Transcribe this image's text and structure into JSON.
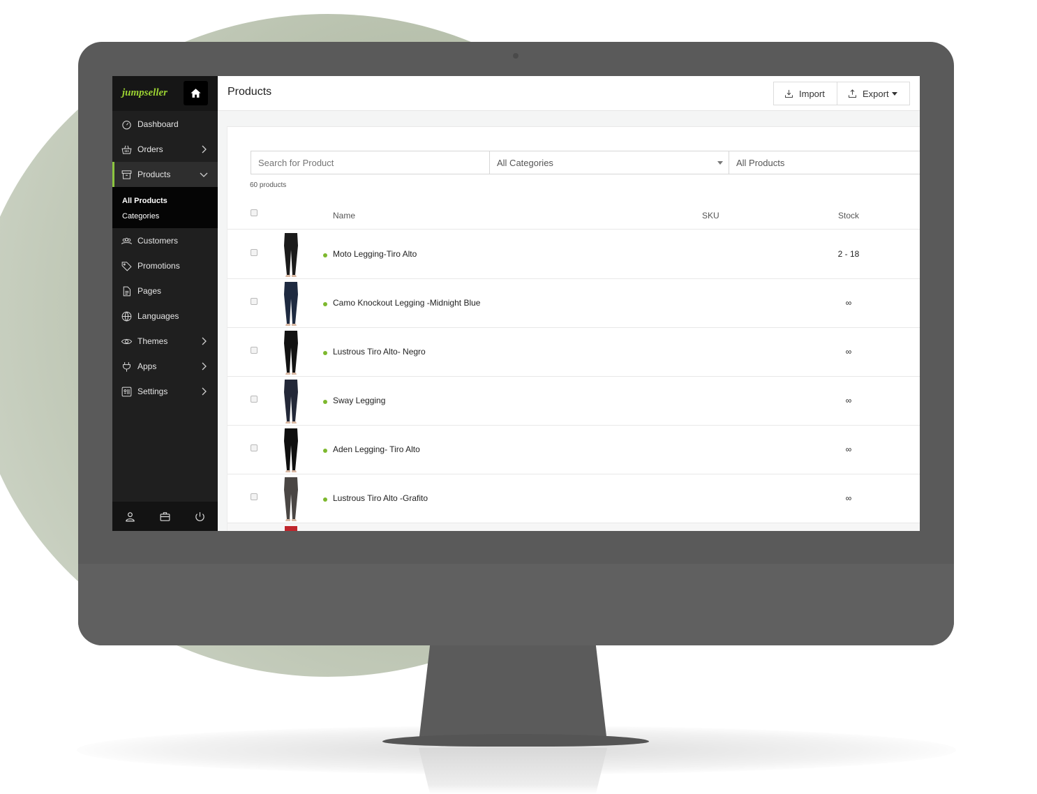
{
  "brand": {
    "logo_text": "jumpseller",
    "accent": "#8cc63f"
  },
  "sidebar": {
    "items": [
      {
        "label": "Dashboard",
        "icon": "gauge-icon",
        "chevron": false
      },
      {
        "label": "Orders",
        "icon": "basket-icon",
        "chevron": true
      },
      {
        "label": "Products",
        "icon": "box-icon",
        "chevron": true,
        "active": true
      },
      {
        "label": "Customers",
        "icon": "users-icon",
        "chevron": false
      },
      {
        "label": "Promotions",
        "icon": "tag-icon",
        "chevron": false
      },
      {
        "label": "Pages",
        "icon": "page-icon",
        "chevron": false
      },
      {
        "label": "Languages",
        "icon": "globe-icon",
        "chevron": false
      },
      {
        "label": "Themes",
        "icon": "eye-icon",
        "chevron": true
      },
      {
        "label": "Apps",
        "icon": "plug-icon",
        "chevron": true
      },
      {
        "label": "Settings",
        "icon": "settings-icon",
        "chevron": true
      }
    ],
    "submenu": [
      "All Products",
      "Categories"
    ],
    "footer_icons": [
      "user-icon",
      "briefcase-icon",
      "power-icon"
    ]
  },
  "header": {
    "title": "Products",
    "import_label": "Import",
    "export_label": "Export"
  },
  "filters": {
    "search_placeholder": "Search for Product",
    "category": "All Categories",
    "scope": "All Products"
  },
  "count_text": "60 products",
  "columns": {
    "name": "Name",
    "sku": "SKU",
    "stock": "Stock"
  },
  "products": [
    {
      "name": "Moto Legging-Tiro Alto",
      "stock": "2 - 18",
      "color": "#1b1b1b"
    },
    {
      "name": "Camo Knockout Legging -Midnight Blue",
      "stock": "∞",
      "color": "#1e2a40"
    },
    {
      "name": "Lustrous Tiro Alto- Negro",
      "stock": "∞",
      "color": "#121212"
    },
    {
      "name": "Sway Legging",
      "stock": "∞",
      "color": "#232838"
    },
    {
      "name": "Aden Legging- Tiro Alto",
      "stock": "∞",
      "color": "#0f0f0f"
    },
    {
      "name": "Lustrous Tiro Alto -Grafito",
      "stock": "∞",
      "color": "#4a4644"
    }
  ]
}
